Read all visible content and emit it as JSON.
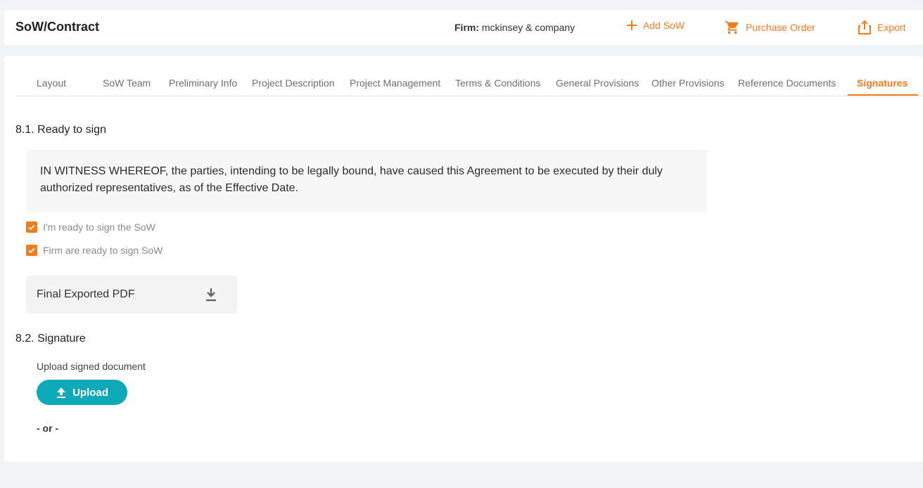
{
  "header": {
    "title": "SoW/Contract",
    "firm_label": "Firm:",
    "firm_value": "mckinsey & company",
    "add_label": "Add SoW",
    "po_label": "Purchase Order",
    "export_label": "Export"
  },
  "tabs": [
    {
      "label": "Layout"
    },
    {
      "label": "SoW Team"
    },
    {
      "label": "Preliminary Info"
    },
    {
      "label": "Project Description"
    },
    {
      "label": "Project Management"
    },
    {
      "label": "Terms & Conditions"
    },
    {
      "label": "General Provisions"
    },
    {
      "label": "Other Provisions"
    },
    {
      "label": "Reference Documents"
    },
    {
      "label": "Signatures",
      "active": true
    }
  ],
  "ready": {
    "title": "8.1. Ready to sign",
    "witness_text": "IN WITNESS WHEREOF, the parties, intending to be legally bound, have caused this Agreement to be executed by their duly authorized representatives, as of the Effective Date.",
    "check_self": "I'm ready to sign the SoW",
    "check_firm": "Firm are ready to sign SoW",
    "pdf_label": "Final Exported PDF"
  },
  "signature": {
    "title": "8.2. Signature",
    "upload_label": "Upload signed document",
    "upload_button": "Upload",
    "or_text": "- or -"
  },
  "colors": {
    "accent": "#f07c1e",
    "upload": "#0fa8b8"
  }
}
